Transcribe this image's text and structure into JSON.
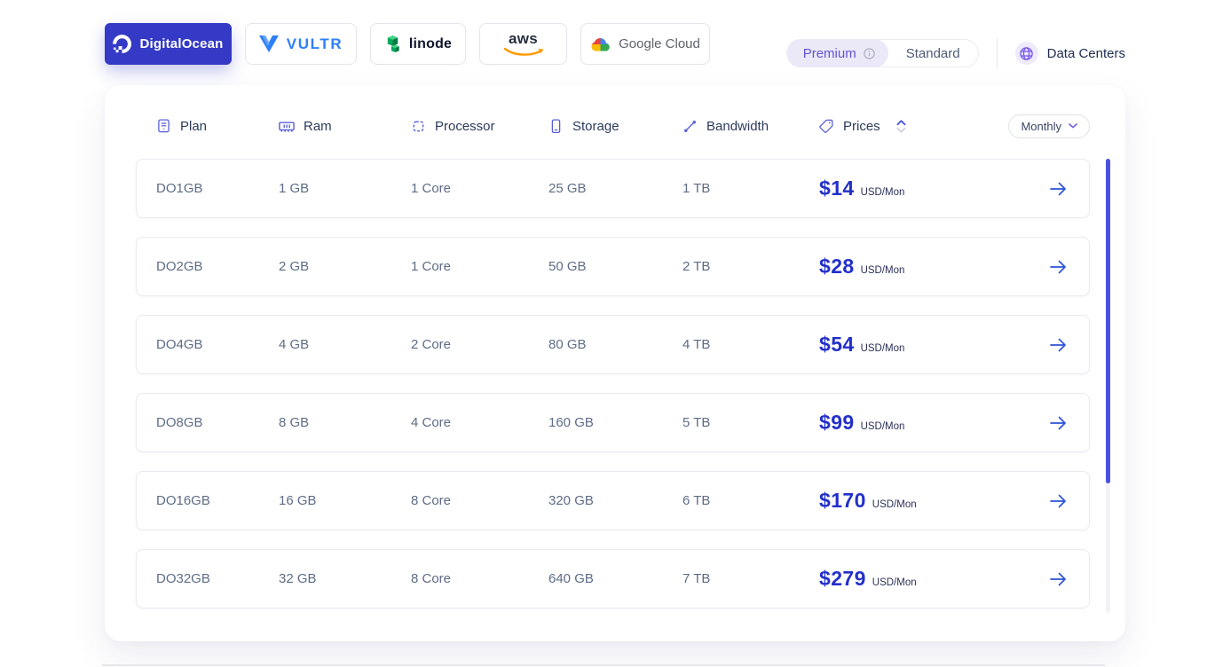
{
  "providers": [
    {
      "label": "DigitalOcean",
      "active": true
    },
    {
      "label": "VULTR",
      "active": false
    },
    {
      "label": "linode",
      "active": false
    },
    {
      "label": "aws",
      "active": false
    },
    {
      "label": "Google Cloud",
      "active": false
    }
  ],
  "plan_toggle": {
    "premium": "Premium",
    "standard": "Standard",
    "selected": "Premium"
  },
  "data_centers_label": "Data Centers",
  "table": {
    "columns": [
      {
        "label": "Plan",
        "icon": "server-icon"
      },
      {
        "label": "Ram",
        "icon": "ram-icon"
      },
      {
        "label": "Processor",
        "icon": "cpu-icon"
      },
      {
        "label": "Storage",
        "icon": "storage-icon"
      },
      {
        "label": "Bandwidth",
        "icon": "bandwidth-icon"
      },
      {
        "label": "Prices",
        "icon": "tag-icon"
      }
    ],
    "period": "Monthly",
    "rows": [
      {
        "plan": "DO1GB",
        "ram": "1 GB",
        "processor": "1 Core",
        "storage": "25 GB",
        "bandwidth": "1 TB",
        "price": "$14",
        "unit": "USD/Mon"
      },
      {
        "plan": "DO2GB",
        "ram": "2 GB",
        "processor": "1 Core",
        "storage": "50 GB",
        "bandwidth": "2 TB",
        "price": "$28",
        "unit": "USD/Mon"
      },
      {
        "plan": "DO4GB",
        "ram": "4 GB",
        "processor": "2 Core",
        "storage": "80 GB",
        "bandwidth": "4 TB",
        "price": "$54",
        "unit": "USD/Mon"
      },
      {
        "plan": "DO8GB",
        "ram": "8 GB",
        "processor": "4 Core",
        "storage": "160 GB",
        "bandwidth": "5 TB",
        "price": "$99",
        "unit": "USD/Mon"
      },
      {
        "plan": "DO16GB",
        "ram": "16 GB",
        "processor": "8 Core",
        "storage": "320 GB",
        "bandwidth": "6 TB",
        "price": "$170",
        "unit": "USD/Mon"
      },
      {
        "plan": "DO32GB",
        "ram": "32 GB",
        "processor": "8 Core",
        "storage": "640 GB",
        "bandwidth": "7 TB",
        "price": "$279",
        "unit": "USD/Mon"
      }
    ]
  },
  "colors": {
    "active_tab": "#3439c6",
    "price_blue": "#2330c9",
    "arrow_blue": "#2c52d8",
    "premium_purple": "#6253cf",
    "premium_bg": "#ebe9f8",
    "globe_purple": "#7c5ce8",
    "vultr_blue": "#2f80f6",
    "linode_green": "#02a85c",
    "aws_orange": "#ff9900",
    "google_blue": "#4285f4",
    "scrollbar": "#4a52dd"
  }
}
